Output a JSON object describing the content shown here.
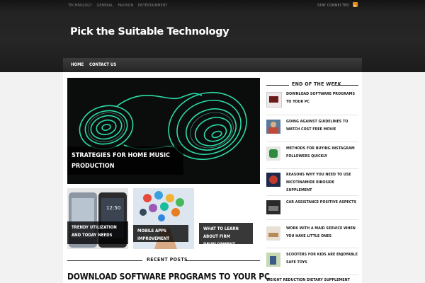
{
  "topnav": {
    "links": [
      "TECHNOLOGY",
      "GENERAL",
      "FASHION",
      "ENTERTAINMENT"
    ],
    "stay_connected": "STAY CONNECTED"
  },
  "site": {
    "title": "Pick the Suitable Technology"
  },
  "mainnav": {
    "items": [
      "HOME",
      "CONTACT US"
    ]
  },
  "featured": {
    "title": "STRATEGIES FOR HOME MUSIC PRODUCTION"
  },
  "thumbs": [
    {
      "title": "TRENDY UTILIZATION AND TODAY NEEDS"
    },
    {
      "title": "MOBILE APPS IMPROVEMENT"
    },
    {
      "title": "WHAT TO LEARN ABOUT FIRM DEVELOPMENT"
    }
  ],
  "recent": {
    "heading": "RECENT POSTS",
    "first_title": "DOWNLOAD SOFTWARE PROGRAMS TO YOUR PC"
  },
  "sidebar": {
    "heading": "END OF THE WEEK",
    "items": [
      "DOWNLOAD SOFTWARE PROGRAMS TO YOUR PC",
      "GOING AGAINST GUIDELINES TO WATCH COST FREE MOVIE",
      "METHODS FOR BUYING INSTAGRAM FOLLOWERS QUICKLY",
      "REASONS WHY YOU NEED TO USE NICOTINAMIDE RIBOSIDE SUPPLEMENT",
      "CAR ASSISTANCE POSITIVE ASPECTS",
      "WORK WITH A MAID SERVICE WHEN YOU HAVE LITTLE ONES",
      "SCOOTERS FOR KIDS ARE ENJOYABLE SAFE TOYS",
      "WEIGHT REDUCTION DIETARY SUPPLEMENT THAT WILL"
    ]
  },
  "colors": {
    "accent_green": "#2ee6b0",
    "rss": "#e68a1e",
    "header_bg": "#232323"
  }
}
